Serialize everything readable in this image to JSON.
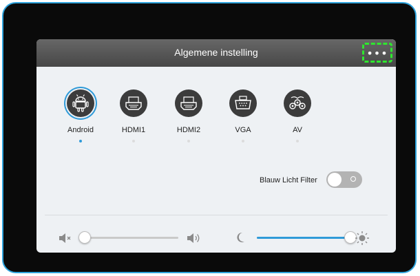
{
  "header": {
    "title": "Algemene instelling",
    "more_icon": "more-dots-icon",
    "more_label": "•••"
  },
  "sources": [
    {
      "label": "Android",
      "icon": "android-icon",
      "active": true
    },
    {
      "label": "HDMI1",
      "icon": "hdmi-icon",
      "active": false
    },
    {
      "label": "HDMI2",
      "icon": "hdmi-icon",
      "active": false
    },
    {
      "label": "VGA",
      "icon": "vga-icon",
      "active": false
    },
    {
      "label": "AV",
      "icon": "av-icon",
      "active": false
    }
  ],
  "blue_light_filter": {
    "label": "Blauw Licht Filter",
    "enabled": false
  },
  "volume": {
    "level": 0.0,
    "icon_left": "volume-mute-icon",
    "icon_right": "volume-high-icon"
  },
  "brightness": {
    "level": 1.0,
    "icon_left": "moon-icon",
    "icon_right": "sun-icon"
  },
  "colors": {
    "accent": "#2f9ad8",
    "frame_border": "#2ea3dc",
    "highlight": "#2ee82e",
    "panel_bg": "#eef1f4",
    "header_bg": "#575757"
  }
}
